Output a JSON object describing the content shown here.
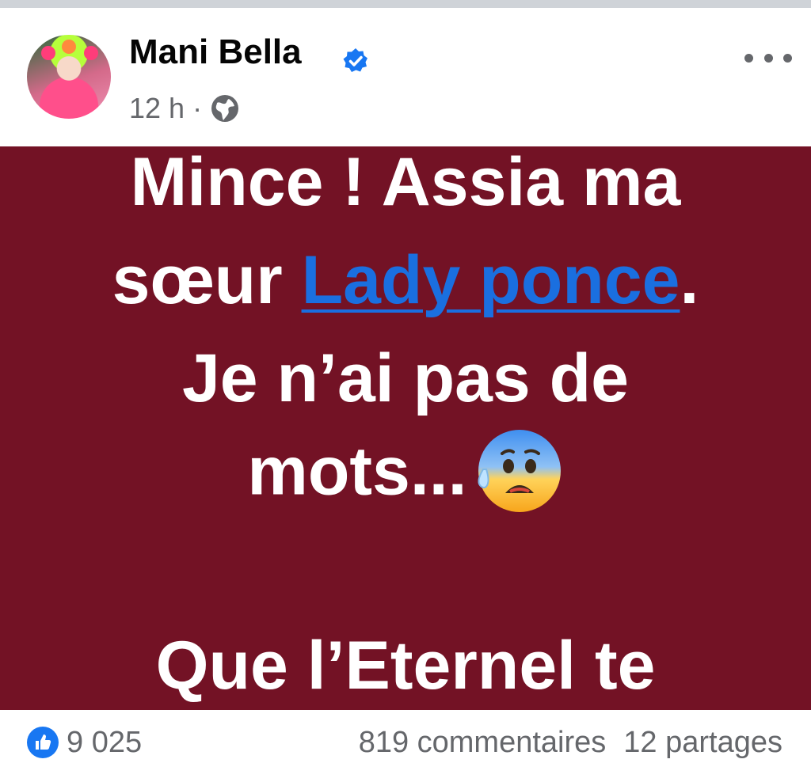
{
  "post": {
    "author": "Mani Bella",
    "time": "12 h",
    "separator": "·",
    "body": {
      "line1": "Mince ! Assia ma",
      "line2_prefix": "sœur ",
      "line2_mention": "Lady ponce",
      "line2_suffix": ".",
      "line3": "Je n’ai pas de",
      "line4": "mots...",
      "line5": "Que l’Eternel te"
    },
    "background_color": "#731225",
    "mention_color": "#1a6fe0"
  },
  "stats": {
    "likes": "9 025",
    "comments": "819 commentaires",
    "shares": "12 partages"
  },
  "icons": {
    "verified": "verified-badge-icon",
    "audience": "globe-icon",
    "more": "more-options-icon",
    "like": "like-reaction-icon",
    "emoji": "anxious-face-with-sweat-emoji"
  }
}
